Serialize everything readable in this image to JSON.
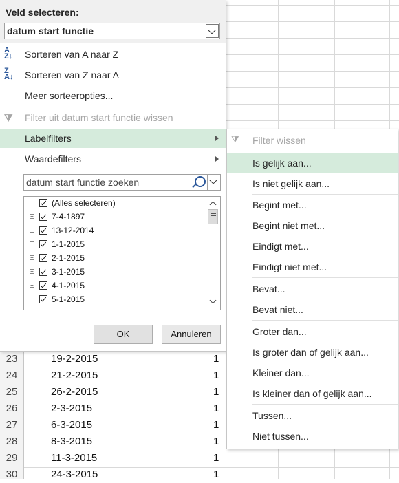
{
  "sheet": {
    "rows": [
      {
        "num": "23",
        "date": "19-2-2015",
        "count": "1"
      },
      {
        "num": "24",
        "date": "21-2-2015",
        "count": "1"
      },
      {
        "num": "25",
        "date": "26-2-2015",
        "count": "1"
      },
      {
        "num": "26",
        "date": "2-3-2015",
        "count": "1"
      },
      {
        "num": "27",
        "date": "6-3-2015",
        "count": "1"
      },
      {
        "num": "28",
        "date": "8-3-2015",
        "count": "1"
      },
      {
        "num": "29",
        "date": "11-3-2015",
        "count": "1"
      },
      {
        "num": "30",
        "date": "24-3-2015",
        "count": "1"
      }
    ]
  },
  "filter": {
    "field_title": "Veld selecteren:",
    "field_value": "datum start functie",
    "menu": {
      "sort_az": "Sorteren van A naar Z",
      "sort_za": "Sorteren van Z naar A",
      "more_sort": "Meer sorteeropties...",
      "clear_filter": "Filter uit datum start functie wissen",
      "label_filters": "Labelfilters",
      "value_filters": "Waardefilters"
    },
    "search_placeholder": "datum start functie zoeken",
    "tree_items": [
      {
        "label": "(Alles selecteren)",
        "checked": true,
        "expandable": false
      },
      {
        "label": "7-4-1897",
        "checked": true,
        "expandable": true
      },
      {
        "label": "13-12-2014",
        "checked": true,
        "expandable": true
      },
      {
        "label": "1-1-2015",
        "checked": true,
        "expandable": true
      },
      {
        "label": "2-1-2015",
        "checked": true,
        "expandable": true
      },
      {
        "label": "3-1-2015",
        "checked": true,
        "expandable": true
      },
      {
        "label": "4-1-2015",
        "checked": true,
        "expandable": true
      },
      {
        "label": "5-1-2015",
        "checked": true,
        "expandable": true
      }
    ],
    "ok_label": "OK",
    "cancel_label": "Annuleren"
  },
  "submenu": {
    "clear": "Filter wissen",
    "equals": "Is gelijk aan...",
    "not_equals": "Is niet gelijk aan...",
    "begins": "Begint met...",
    "not_begins": "Begint niet met...",
    "ends": "Eindigt met...",
    "not_ends": "Eindigt niet met...",
    "contains": "Bevat...",
    "not_contains": "Bevat niet...",
    "greater": "Groter dan...",
    "greater_eq": "Is groter dan of gelijk aan...",
    "less": "Kleiner dan...",
    "less_eq": "Is kleiner dan of gelijk aan...",
    "between": "Tussen...",
    "not_between": "Niet tussen..."
  },
  "colors": {
    "highlight": "#d5ebdc",
    "disabled_text": "#a6a6a6",
    "accent": "#2b579a"
  }
}
